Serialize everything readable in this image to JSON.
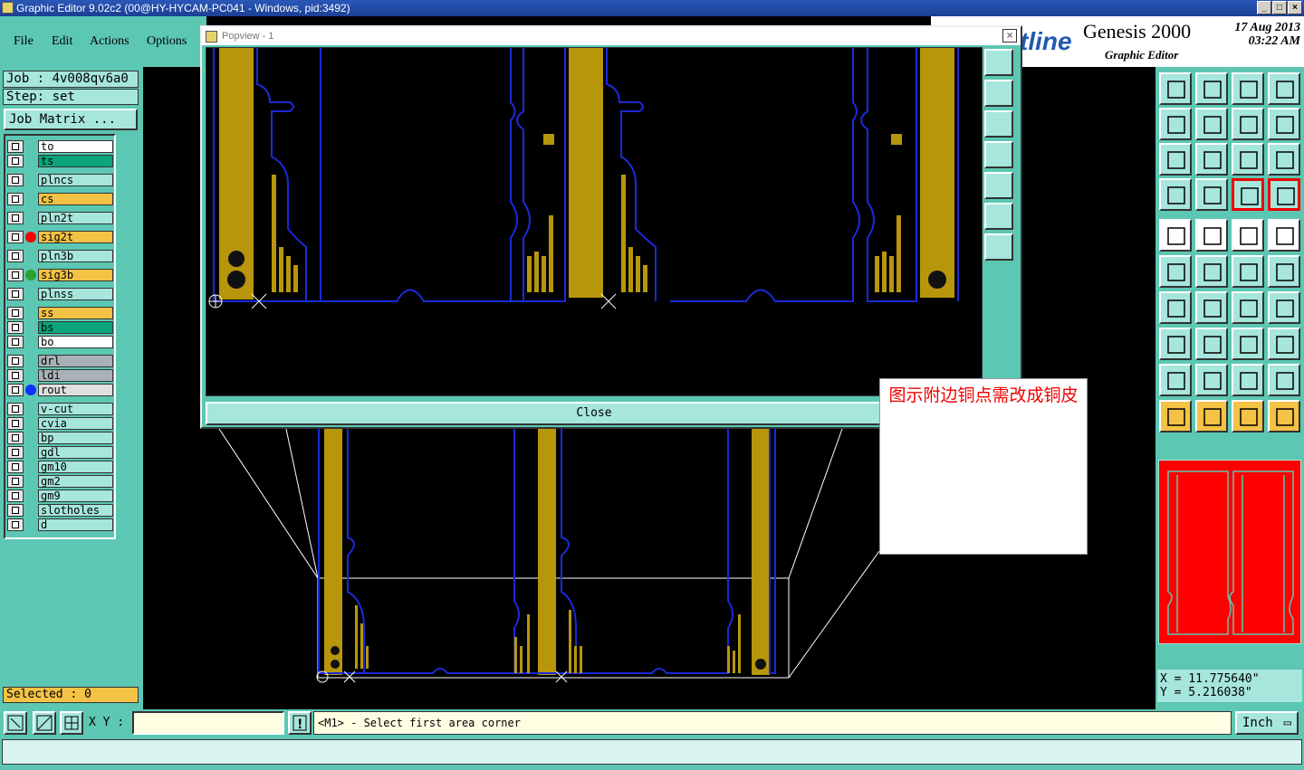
{
  "window": {
    "title": "Graphic Editor 9.02c2 (00@HY-HYCAM-PC041 - Windows, pid:3492)"
  },
  "menu": {
    "items": [
      "File",
      "Edit",
      "Actions",
      "Options"
    ]
  },
  "header": {
    "logo_fragment": "tline",
    "product": "Genesis 2000",
    "subtitle": "Graphic Editor",
    "date": "17 Aug 2013",
    "time": "03:22 AM"
  },
  "job": {
    "label": "Job : 4v008qv6a0",
    "step": "Step: set",
    "matrix_button": "Job Matrix ..."
  },
  "layers": [
    {
      "name": "to",
      "color": "#ffffff",
      "dot": null
    },
    {
      "name": "ts",
      "color": "#0aa57a",
      "dot": null
    },
    {
      "name": "plncs",
      "color": "#a6e6dc",
      "dot": null
    },
    {
      "name": "cs",
      "color": "#f4c245",
      "dot": null
    },
    {
      "name": "pln2t",
      "color": "#a6e6dc",
      "dot": null
    },
    {
      "name": "sig2t",
      "color": "#f4c245",
      "dot": "#ff0000"
    },
    {
      "name": "pln3b",
      "color": "#a6e6dc",
      "dot": null
    },
    {
      "name": "sig3b",
      "color": "#f4c245",
      "dot": "#2ea02e"
    },
    {
      "name": "plnss",
      "color": "#a6e6dc",
      "dot": null
    },
    {
      "name": "ss",
      "color": "#f4c245",
      "dot": null
    },
    {
      "name": "bs",
      "color": "#0aa57a",
      "dot": null
    },
    {
      "name": "bo",
      "color": "#ffffff",
      "dot": null
    },
    {
      "name": "drl",
      "color": "#a8b2b6",
      "dot": null
    },
    {
      "name": "ldi",
      "color": "#a8b2b6",
      "dot": null
    },
    {
      "name": "rout",
      "color": "#e0e0e0",
      "dot": "#1030ff"
    },
    {
      "name": "v-cut",
      "color": "#a6e6dc",
      "dot": null
    },
    {
      "name": "cvia",
      "color": "#a6e6dc",
      "dot": null
    },
    {
      "name": "bp",
      "color": "#a6e6dc",
      "dot": null
    },
    {
      "name": "gdl",
      "color": "#a6e6dc",
      "dot": null
    },
    {
      "name": "gm10",
      "color": "#a6e6dc",
      "dot": null
    },
    {
      "name": "gm2",
      "color": "#a6e6dc",
      "dot": null
    },
    {
      "name": "gm9",
      "color": "#a6e6dc",
      "dot": null
    },
    {
      "name": "slotholes",
      "color": "#a6e6dc",
      "dot": null
    },
    {
      "name": "d",
      "color": "#a6e6dc",
      "dot": null
    }
  ],
  "selected": "Selected : 0",
  "popview": {
    "title": "Popview - 1",
    "close_label": "Close"
  },
  "note": "图示附边铜点需改成铜皮",
  "coords": {
    "x": "X = 11.775640\"",
    "y": "Y = 5.216038\""
  },
  "command": {
    "xy_label": "X Y :",
    "xy_value": "",
    "message": "<M1> - Select first area corner",
    "units": "Inch"
  },
  "colors": {
    "panel": "#5cc7b3",
    "copper": "#b8960c",
    "outline": "#1a2ad8",
    "field": "#a6e6dc"
  }
}
